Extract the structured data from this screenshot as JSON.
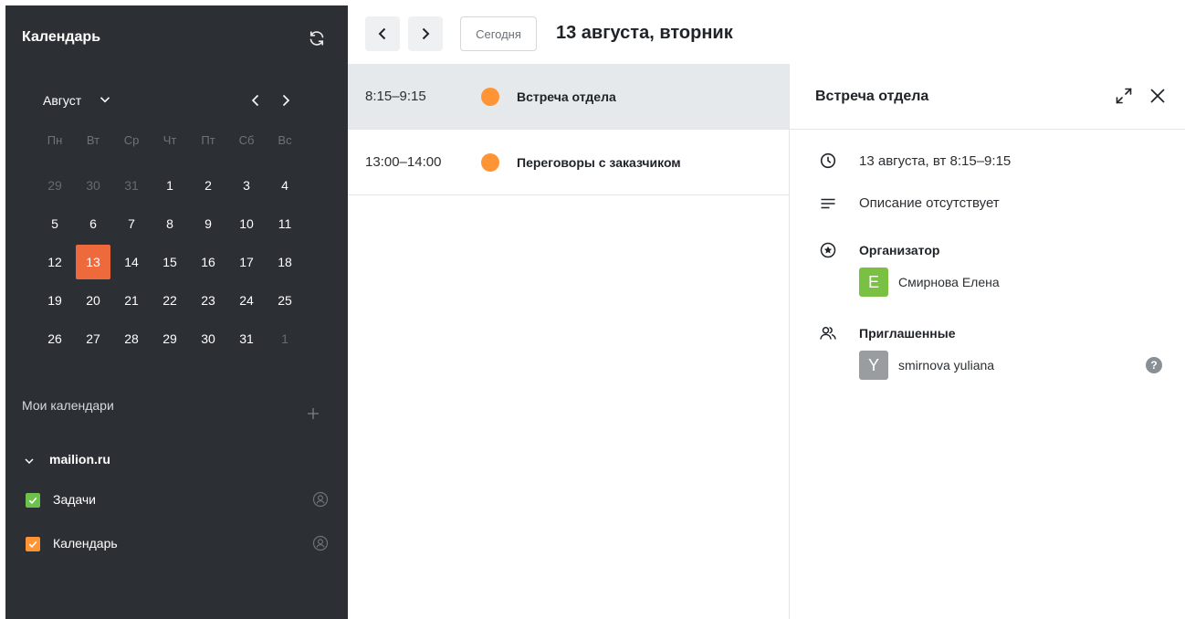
{
  "sidebar": {
    "title": "Календарь",
    "month": "Август",
    "weekdays": [
      "Пн",
      "Вт",
      "Ср",
      "Чт",
      "Пт",
      "Сб",
      "Вс"
    ],
    "weeks": [
      [
        "29",
        "30",
        "31",
        "1",
        "2",
        "3",
        "4"
      ],
      [
        "5",
        "6",
        "7",
        "8",
        "9",
        "10",
        "11"
      ],
      [
        "12",
        "13",
        "14",
        "15",
        "16",
        "17",
        "18"
      ],
      [
        "19",
        "20",
        "21",
        "22",
        "23",
        "24",
        "25"
      ],
      [
        "26",
        "27",
        "28",
        "29",
        "30",
        "31",
        "1"
      ]
    ],
    "today": "13",
    "my_calendars_label": "Мои календари",
    "domain": "mailion.ru",
    "calendars": [
      {
        "name": "Задачи",
        "color": "#6cc24a",
        "checked": true
      },
      {
        "name": "Календарь",
        "color": "#ff9435",
        "checked": true
      }
    ]
  },
  "toolbar": {
    "today_label": "Сегодня",
    "date_title": "13 августа, вторник"
  },
  "events": [
    {
      "time": "8:15–9:15",
      "title": "Встреча отдела",
      "color": "#ff9435",
      "selected": true
    },
    {
      "time": "13:00–14:00",
      "title": "Переговоры с заказчиком",
      "color": "#ff9435",
      "selected": false
    }
  ],
  "detail": {
    "title": "Встреча отдела",
    "datetime": "13 августа, вт 8:15–9:15",
    "description": "Описание отсутствует",
    "organizer_label": "Организатор",
    "organizer": {
      "initial": "E",
      "name": "Смирнова Елена",
      "color": "#7ac143"
    },
    "invited_label": "Приглашенные",
    "invitees": [
      {
        "initial": "Y",
        "name": "smirnova yuliana",
        "color": "#9a9da0",
        "status_icon": "?"
      }
    ]
  },
  "colors": {
    "sidebar_bg": "#2c3034",
    "accent_today": "#ee6a3d",
    "event_dot": "#ff9435"
  }
}
